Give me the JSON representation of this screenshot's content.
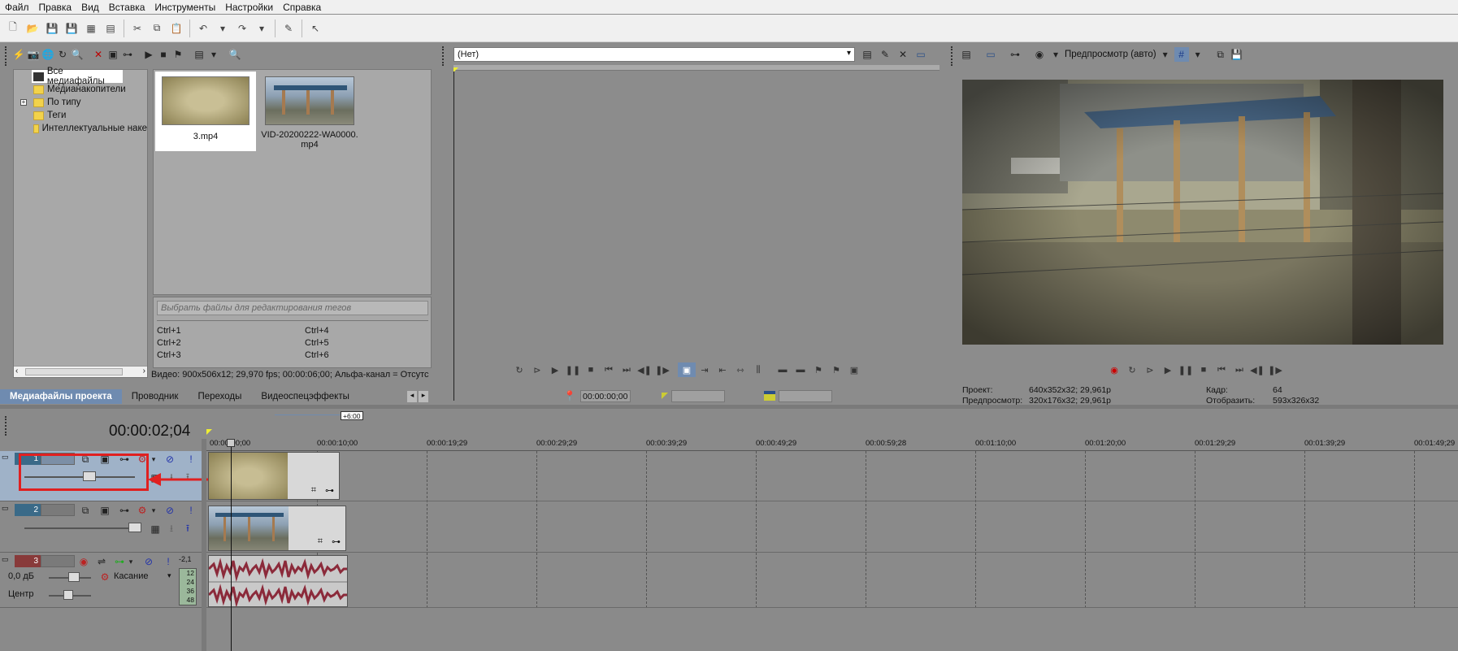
{
  "menu": [
    "Файл",
    "Правка",
    "Вид",
    "Вставка",
    "Инструменты",
    "Настройки",
    "Справка"
  ],
  "explorer": {
    "tree": [
      "Все медиафайлы",
      "Медианакопители",
      "По типу",
      "Теги",
      "Интеллектуальные наке"
    ],
    "thumbs": [
      {
        "label": "3.mp4"
      },
      {
        "label": "VID-20200222-WA0000.\nmp4"
      }
    ],
    "tag_placeholder": "Выбрать файлы для редактирования тегов",
    "shortcuts_left": [
      "Ctrl+1",
      "Ctrl+2",
      "Ctrl+3"
    ],
    "shortcuts_right": [
      "Ctrl+4",
      "Ctrl+5",
      "Ctrl+6"
    ],
    "status": "Видео: 900x506x12; 29,970 fps; 00:00:06;00; Альфа-канал = Отсутс",
    "tabs": [
      "Медиафайлы проекта",
      "Проводник",
      "Переходы",
      "Видеоспецэффекты"
    ]
  },
  "trimmer": {
    "source": "(Нет)",
    "timecode": "00:00:00;00"
  },
  "preview": {
    "mode": "Предпросмотр (авто)",
    "project_label": "Проект:",
    "project_value": "640x352x32; 29,961p",
    "preview_label": "Предпросмотр:",
    "preview_value": "320x176x32; 29,961p",
    "frame_label": "Кадр:",
    "frame_value": "64",
    "display_label": "Отобразить:",
    "display_value": "593x326x32"
  },
  "timeline": {
    "timecode": "00:00:02;04",
    "rate": "+6:00",
    "ruler": [
      "00:00:00;00",
      "00:00:10;00",
      "00:00:19;29",
      "00:00:29;29",
      "00:00:39;29",
      "00:00:49;29",
      "00:00:59;28",
      "00:01:10;00",
      "00:01:20;00",
      "00:01:29;29",
      "00:01:39;29",
      "00:01:49;29"
    ],
    "tracks": [
      {
        "num": "1"
      },
      {
        "num": "2"
      },
      {
        "num": "3",
        "db": "0,0 дБ",
        "pan": "Центр",
        "mode": "Касание",
        "level": "-2,1",
        "meter": [
          "12",
          "24",
          "36",
          "48"
        ]
      }
    ]
  },
  "colors": {
    "accent": "#e02020",
    "track_video": "#3a6a88",
    "track_audio": "#883a3a",
    "waveform": "#8b2a3a"
  }
}
